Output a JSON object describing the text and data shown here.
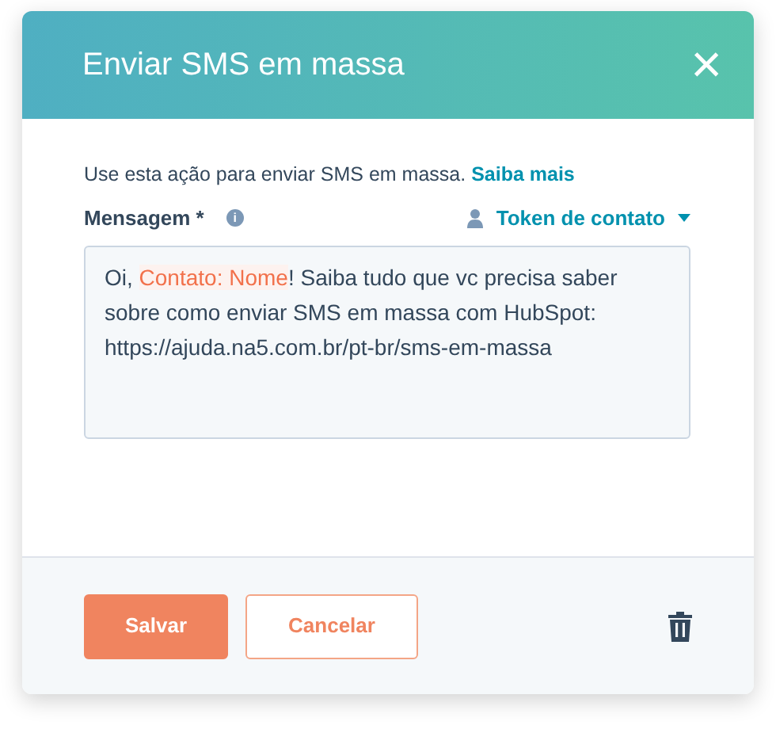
{
  "dialog": {
    "title": "Enviar SMS em massa",
    "close": "×"
  },
  "intro": {
    "text": "Use esta ação para enviar SMS em massa.",
    "link": "Saiba mais"
  },
  "message": {
    "label": "Mensagem *",
    "info": "i",
    "token_menu": "Token de contato",
    "content": [
      {
        "kind": "text",
        "text": "Oi, "
      },
      {
        "kind": "token",
        "text": "Contato: Nome"
      },
      {
        "kind": "text",
        "text": "! Saiba tudo que vc precisa saber sobre como enviar SMS em massa com HubSpot: https://ajuda.na5.com.br/pt-br/sms-em-massa"
      }
    ]
  },
  "footer": {
    "buttons": [
      {
        "kind": "primary",
        "label": "Salvar"
      },
      {
        "kind": "secondary",
        "label": "Cancelar"
      }
    ]
  }
}
